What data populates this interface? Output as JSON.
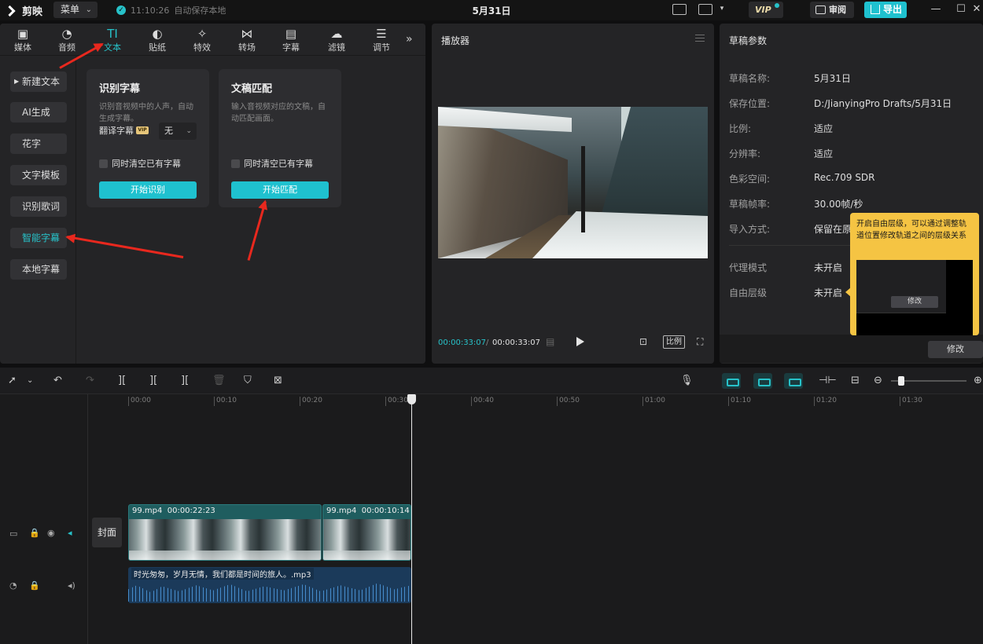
{
  "app": {
    "name": "剪映",
    "menu_label": "菜单",
    "autosave_time": "11:10:26",
    "autosave_text": "自动保存本地",
    "doc_title": "5月31日",
    "vip": "VIP",
    "review": "审阅",
    "export": "导出"
  },
  "tabs": [
    {
      "label": "媒体",
      "glyph": "▣"
    },
    {
      "label": "音频",
      "glyph": "◔"
    },
    {
      "label": "文本",
      "glyph": "TI"
    },
    {
      "label": "贴纸",
      "glyph": "◐"
    },
    {
      "label": "特效",
      "glyph": "✧"
    },
    {
      "label": "转场",
      "glyph": "⋈"
    },
    {
      "label": "字幕",
      "glyph": "▤"
    },
    {
      "label": "滤镜",
      "glyph": "☁"
    },
    {
      "label": "调节",
      "glyph": "☰"
    }
  ],
  "tab_more": "»",
  "sidebar": [
    {
      "label": "新建文本"
    },
    {
      "label": "AI生成"
    },
    {
      "label": "花字"
    },
    {
      "label": "文字模板"
    },
    {
      "label": "识别歌词"
    },
    {
      "label": "智能字幕"
    },
    {
      "label": "本地字幕"
    }
  ],
  "card_recognize": {
    "title": "识别字幕",
    "desc": "识别音视频中的人声，自动生成字幕。",
    "translate_label": "翻译字幕",
    "vip_chip": "VIP",
    "select_value": "无",
    "clear_label": "同时清空已有字幕",
    "button": "开始识别"
  },
  "card_match": {
    "title": "文稿匹配",
    "desc": "输入音视频对应的文稿，自动匹配画面。",
    "clear_label": "同时清空已有字幕",
    "button": "开始匹配"
  },
  "player": {
    "title": "播放器",
    "time_current": "00:00:33:07",
    "time_sep": "/",
    "time_total": "00:00:33:07",
    "ratio": "比例"
  },
  "draft": {
    "title": "草稿参数",
    "rows": [
      {
        "label": "草稿名称:",
        "value": "5月31日"
      },
      {
        "label": "保存位置:",
        "value": "D:/JianyingPro Drafts/5月31日"
      },
      {
        "label": "比例:",
        "value": "适应"
      },
      {
        "label": "分辨率:",
        "value": "适应"
      },
      {
        "label": "色彩空间:",
        "value": "Rec.709 SDR"
      },
      {
        "label": "草稿帧率:",
        "value": "30.00帧/秒"
      },
      {
        "label": "导入方式:",
        "value": "保留在原"
      },
      {
        "label": "代理模式",
        "value": "未开启"
      },
      {
        "label": "自由层级",
        "value": "未开启"
      }
    ],
    "modify": "修改"
  },
  "tooltip": {
    "text": "开启自由层级，可以通过调整轨道位置修改轨道之间的层级关系",
    "preview_button": "修改"
  },
  "timeline": {
    "ticks": [
      "00:00",
      "00:10",
      "00:20",
      "00:30",
      "00:40",
      "00:50",
      "01:00",
      "01:10",
      "01:20",
      "01:30"
    ],
    "cover": "封面",
    "clips": [
      {
        "name": "99.mp4",
        "duration": "00:00:22:23"
      },
      {
        "name": "99.mp4",
        "duration": "00:00:10:14"
      }
    ],
    "audio": {
      "name": "时光匆匆，岁月无情，我们都是时间的旅人。.mp3"
    }
  },
  "colors": {
    "accent": "#1fc1cf",
    "arrow": "#e8281e",
    "tooltip": "#f5c443"
  }
}
